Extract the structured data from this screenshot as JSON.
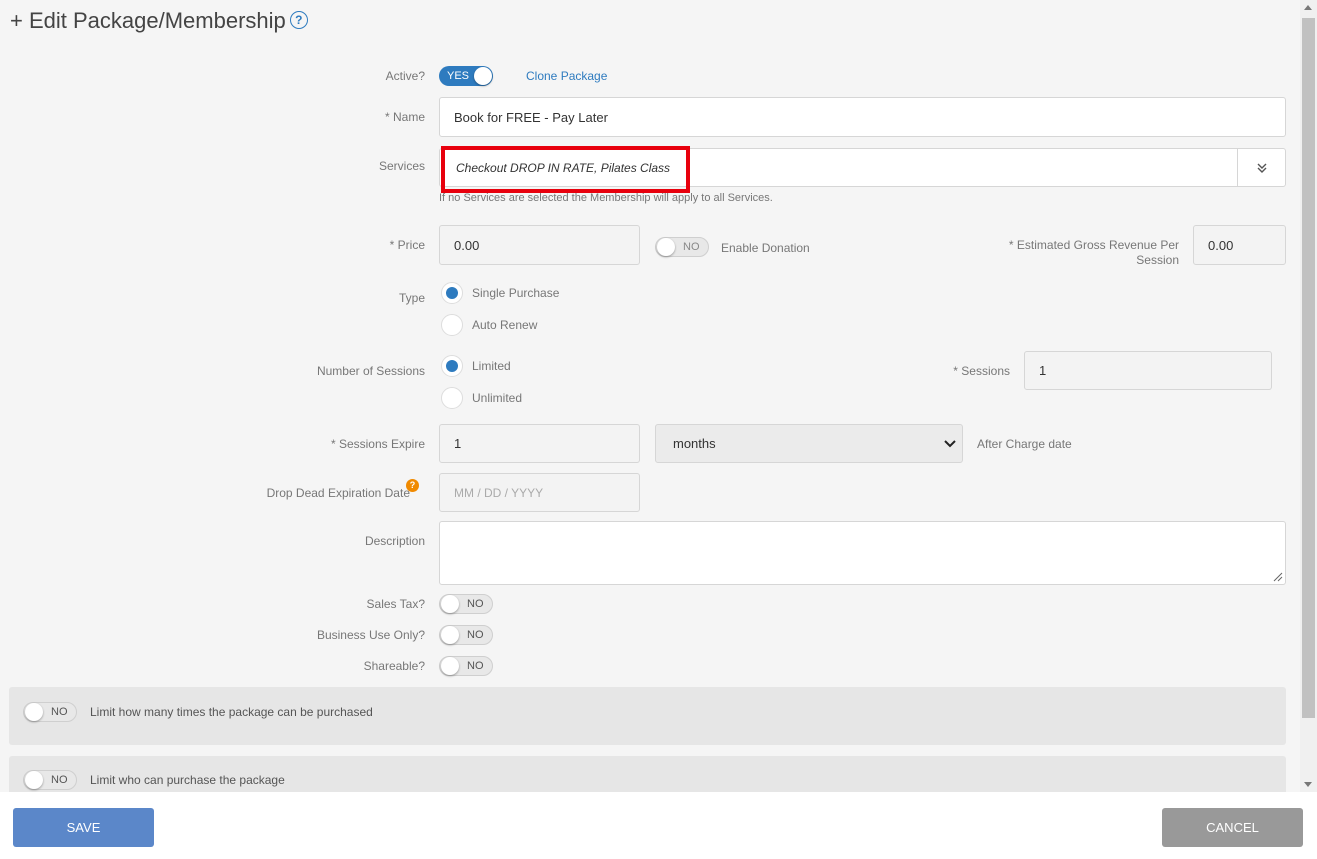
{
  "header": {
    "title": "+ Edit Package/Membership",
    "help_icon_text": "?"
  },
  "form": {
    "active": {
      "label": "Active?",
      "toggle": "YES",
      "clone_link": "Clone Package"
    },
    "name": {
      "label": "* Name",
      "value": "Book for FREE - Pay Later"
    },
    "services": {
      "label": "Services",
      "value": "Checkout DROP IN RATE, Pilates Class",
      "hint": "If no Services are selected the Membership will apply to all Services.",
      "expand_icon": "chevron-double-down-icon"
    },
    "price": {
      "label": "* Price",
      "value": "0.00",
      "donation_toggle": "NO",
      "donation_label": "Enable Donation"
    },
    "revenue": {
      "label_line1": "* Estimated Gross Revenue Per",
      "label_line2": "Session",
      "value": "0.00"
    },
    "type": {
      "label": "Type",
      "options": [
        "Single Purchase",
        "Auto Renew"
      ],
      "selected": "Single Purchase"
    },
    "sessions_count": {
      "label": "Number of Sessions",
      "options": [
        "Limited",
        "Unlimited"
      ],
      "selected": "Limited",
      "sessions_label": "* Sessions",
      "sessions_value": "1"
    },
    "expire": {
      "label": "* Sessions Expire",
      "value": "1",
      "unit": "months",
      "after": "After Charge date"
    },
    "drop_dead": {
      "label": "Drop Dead Expiration Date",
      "help": "?",
      "placeholder": "MM / DD / YYYY"
    },
    "description": {
      "label": "Description",
      "value": ""
    },
    "sales_tax": {
      "label": "Sales Tax?",
      "toggle": "NO"
    },
    "business_use": {
      "label": "Business Use Only?",
      "toggle": "NO"
    },
    "shareable": {
      "label": "Shareable?",
      "toggle": "NO"
    }
  },
  "panels": [
    {
      "toggle": "NO",
      "label": "Limit how many times the package can be purchased"
    },
    {
      "toggle": "NO",
      "label": "Limit who can purchase the package"
    }
  ],
  "footer": {
    "save": "SAVE",
    "cancel": "CANCEL"
  },
  "colors": {
    "accent": "#2e7bbf",
    "highlight": "#e8000d",
    "save_button": "#5b87c9",
    "cancel_button": "#999999",
    "help_badge": "#f08a00"
  }
}
